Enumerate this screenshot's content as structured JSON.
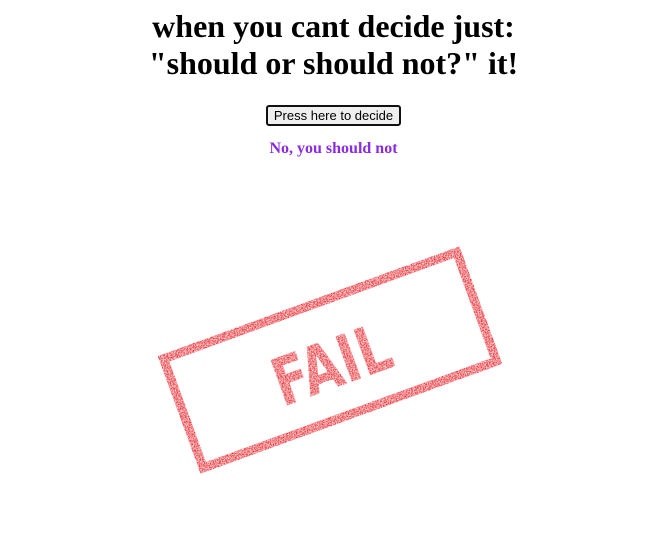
{
  "header": {
    "title_line1": "when you cant decide just:",
    "title_line2": "\"should or should not?\" it!"
  },
  "controls": {
    "decide_button_label": "Press here to decide"
  },
  "result": {
    "answer_text": "No, you should not",
    "answer_color": "#8a2be2"
  },
  "stamp": {
    "icon": "fail-stamp-icon",
    "text": "FAIL",
    "color": "#e8141b"
  }
}
